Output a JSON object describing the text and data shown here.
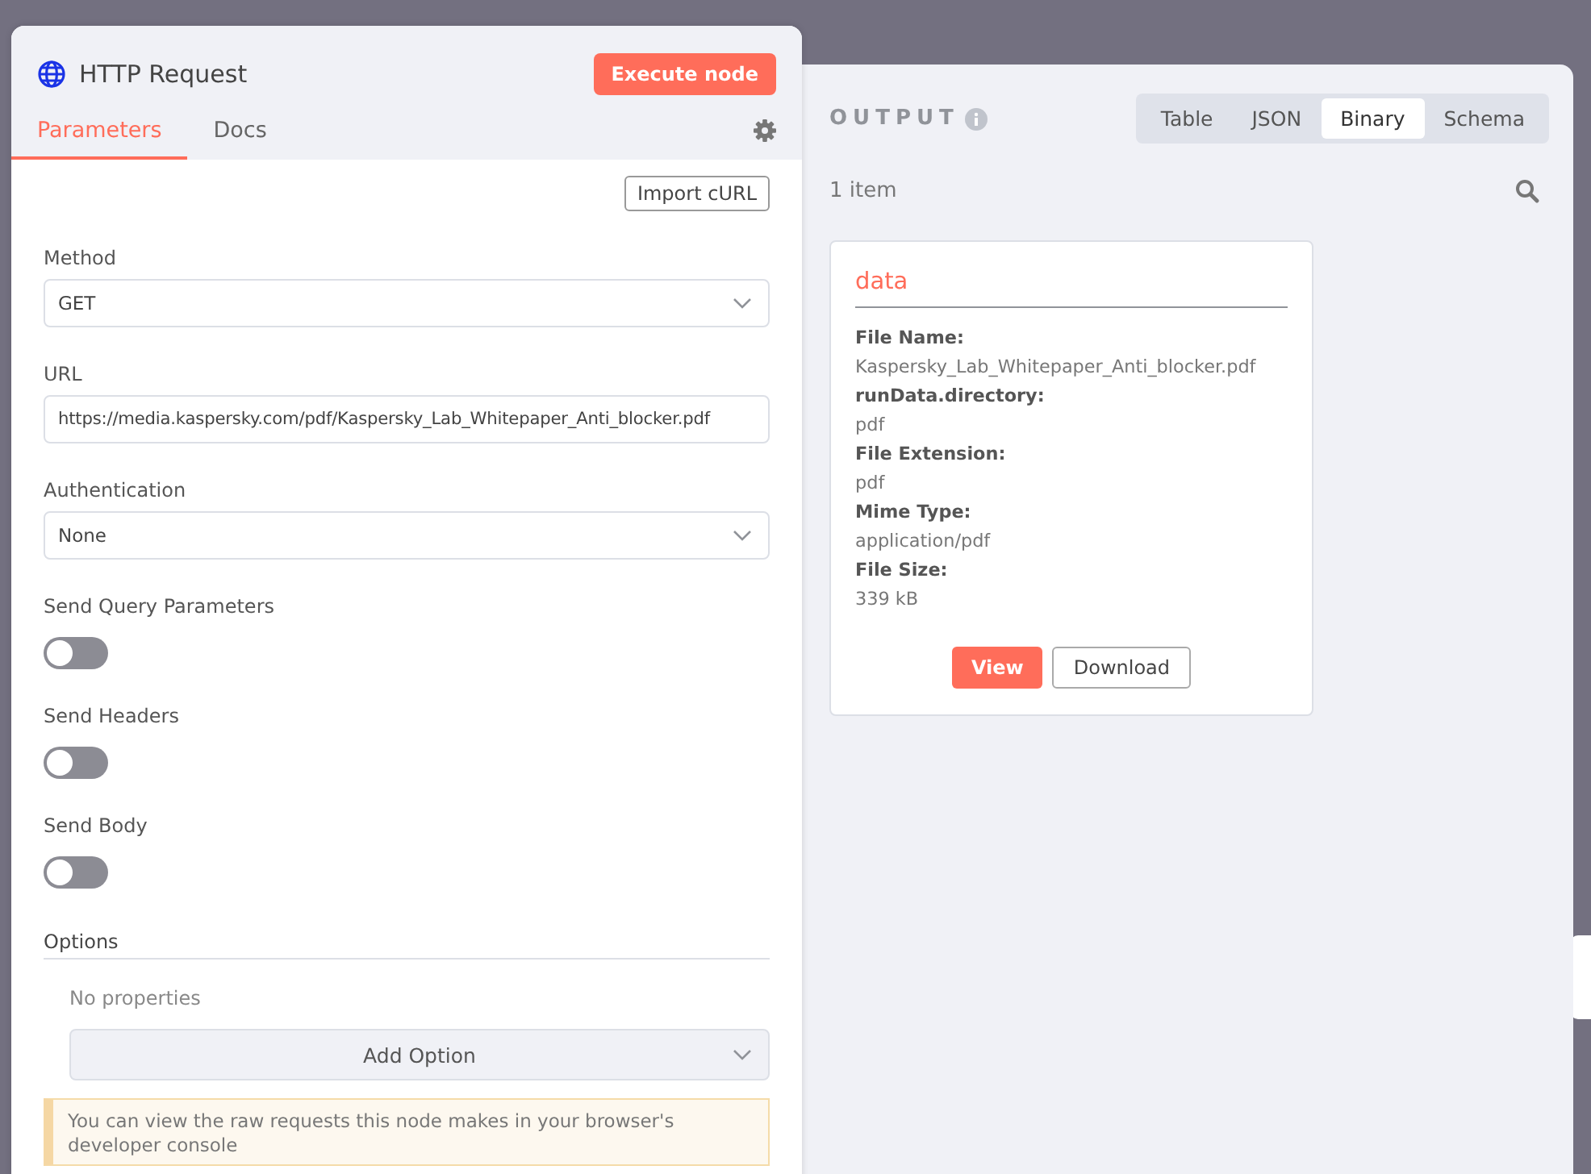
{
  "node_panel": {
    "title": "HTTP Request",
    "execute_button": "Execute node",
    "tabs": [
      {
        "label": "Parameters",
        "selected": true
      },
      {
        "label": "Docs",
        "selected": false
      }
    ],
    "import_button": "Import cURL",
    "fields": [
      {
        "kind": "select",
        "label": "Method",
        "value": "GET"
      },
      {
        "kind": "text",
        "label": "URL",
        "value": "https://media.kaspersky.com/pdf/Kaspersky_Lab_Whitepaper_Anti_blocker.pdf"
      },
      {
        "kind": "select",
        "label": "Authentication",
        "value": "None"
      },
      {
        "kind": "toggle",
        "label": "Send Query Parameters",
        "on": false
      },
      {
        "kind": "toggle",
        "label": "Send Headers",
        "on": false
      },
      {
        "kind": "toggle",
        "label": "Send Body",
        "on": false
      }
    ],
    "options": {
      "title": "Options",
      "empty_text": "No properties",
      "add_button": "Add Option"
    },
    "notice": "You can view the raw requests this node makes in your browser's developer console"
  },
  "output_panel": {
    "title": "OUTPUT",
    "view_tabs": [
      {
        "label": "Table",
        "selected": false
      },
      {
        "label": "JSON",
        "selected": false
      },
      {
        "label": "Binary",
        "selected": true
      },
      {
        "label": "Schema",
        "selected": false
      }
    ],
    "item_count": "1 item",
    "binary_card": {
      "title": "data",
      "entries": [
        {
          "key": "File Name:",
          "value": "Kaspersky_Lab_Whitepaper_Anti_blocker.pdf"
        },
        {
          "key": "runData.directory:",
          "value": "pdf"
        },
        {
          "key": "File Extension:",
          "value": "pdf"
        },
        {
          "key": "Mime Type:",
          "value": "application/pdf"
        },
        {
          "key": "File Size:",
          "value": "339 kB"
        }
      ],
      "view_button": "View",
      "download_button": "Download"
    }
  }
}
